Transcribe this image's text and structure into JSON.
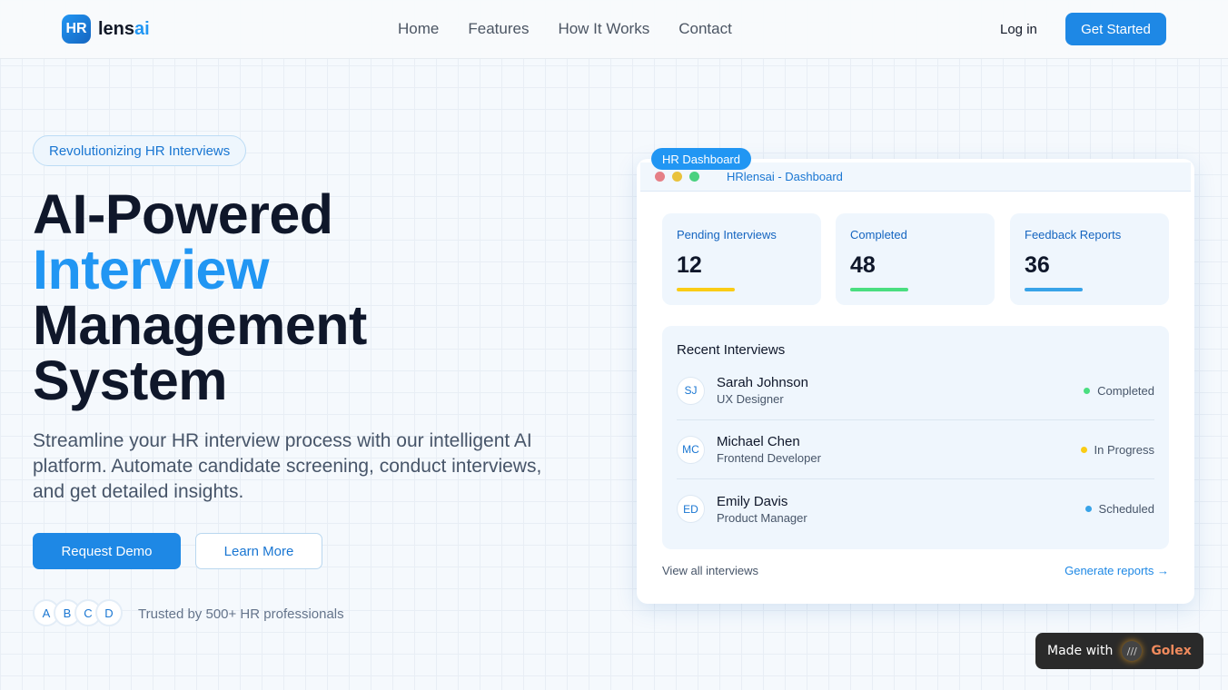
{
  "nav": {
    "logo_mark": "HR",
    "logo_a": "lens",
    "logo_b": "ai",
    "links": [
      "Home",
      "Features",
      "How It Works",
      "Contact"
    ],
    "login": "Log in",
    "get_started": "Get Started"
  },
  "hero": {
    "pill": "Revolutionizing HR Interviews",
    "l1": "AI-Powered",
    "l2": "Interview",
    "l3": "Management",
    "l4": "System",
    "lead": "Streamline your HR interview process with our intelligent AI platform. Automate candidate screening, conduct interviews, and get detailed insights.",
    "demo": "Request Demo",
    "learn": "Learn More",
    "avatars": [
      "A",
      "B",
      "C",
      "D"
    ],
    "trust": "Trusted by 500+ HR professionals"
  },
  "dash": {
    "tag": "HR Dashboard",
    "title": "HRlensai - Dashboard",
    "stats": [
      {
        "label": "Pending Interviews",
        "value": "12",
        "color": "#facc15"
      },
      {
        "label": "Completed",
        "value": "48",
        "color": "#4ade80"
      },
      {
        "label": "Feedback Reports",
        "value": "36",
        "color": "#38a3e8"
      }
    ],
    "recent_title": "Recent Interviews",
    "rows": [
      {
        "ini": "SJ",
        "name": "Sarah Johnson",
        "role": "UX Designer",
        "status": "Completed",
        "color": "#4ade80"
      },
      {
        "ini": "MC",
        "name": "Michael Chen",
        "role": "Frontend Developer",
        "status": "In Progress",
        "color": "#facc15"
      },
      {
        "ini": "ED",
        "name": "Emily Davis",
        "role": "Product Manager",
        "status": "Scheduled",
        "color": "#38a3e8"
      }
    ],
    "view_all": "View all interviews",
    "generate": "Generate reports →"
  },
  "badge": {
    "made": "Made with",
    "brand": "Golex"
  }
}
